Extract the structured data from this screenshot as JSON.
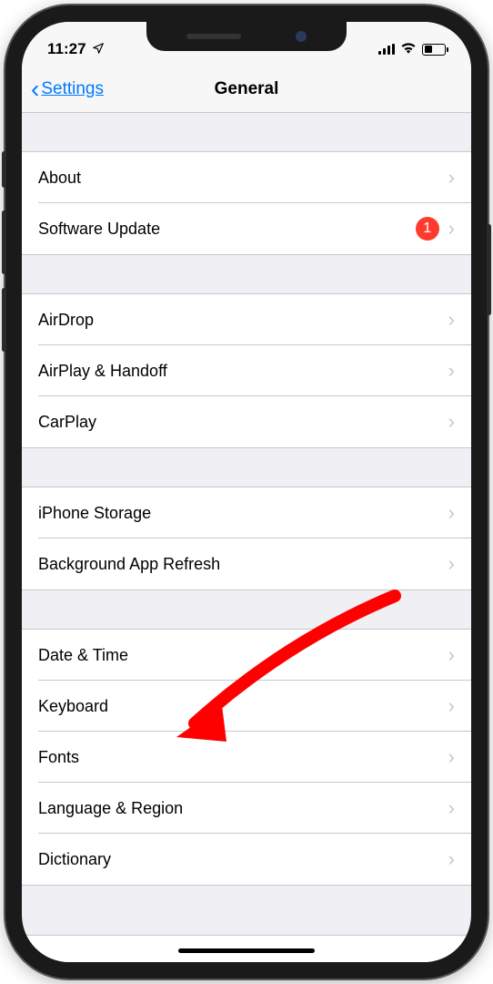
{
  "status": {
    "time": "11:27",
    "location_icon": "location-arrow"
  },
  "nav": {
    "back_label": "Settings",
    "title": "General"
  },
  "groups": [
    {
      "rows": [
        {
          "label": "About",
          "badge": null
        },
        {
          "label": "Software Update",
          "badge": "1"
        }
      ]
    },
    {
      "rows": [
        {
          "label": "AirDrop",
          "badge": null
        },
        {
          "label": "AirPlay & Handoff",
          "badge": null
        },
        {
          "label": "CarPlay",
          "badge": null
        }
      ]
    },
    {
      "rows": [
        {
          "label": "iPhone Storage",
          "badge": null
        },
        {
          "label": "Background App Refresh",
          "badge": null
        }
      ]
    },
    {
      "rows": [
        {
          "label": "Date & Time",
          "badge": null
        },
        {
          "label": "Keyboard",
          "badge": null
        },
        {
          "label": "Fonts",
          "badge": null
        },
        {
          "label": "Language & Region",
          "badge": null
        },
        {
          "label": "Dictionary",
          "badge": null
        }
      ]
    }
  ],
  "cutoff": {
    "left_partial": "",
    "right_partial": ""
  },
  "annotation": {
    "type": "arrow",
    "target": "Keyboard",
    "color": "#ff0000"
  }
}
